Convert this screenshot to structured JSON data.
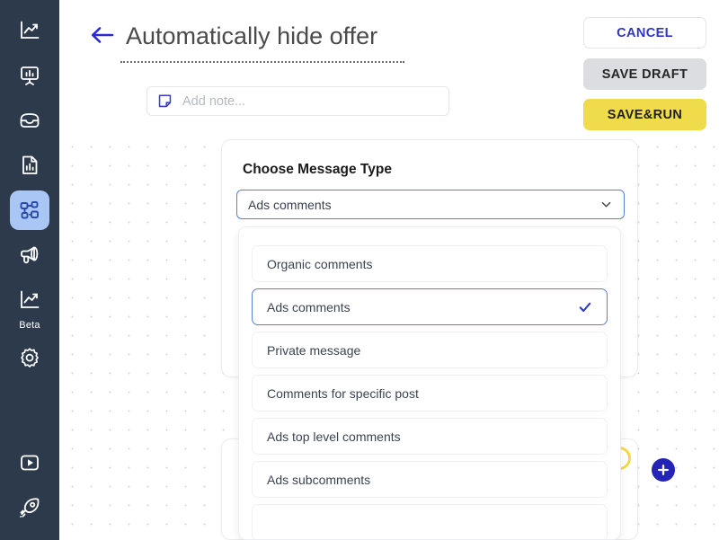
{
  "sidebar": {
    "items": [
      {
        "name": "analytics-chart-icon",
        "icon": "line-chart-axis-icon",
        "label": ""
      },
      {
        "name": "presentation-board-icon",
        "icon": "presentation-chart-icon",
        "label": ""
      },
      {
        "name": "inbox-icon",
        "icon": "inbox-tray-icon",
        "label": ""
      },
      {
        "name": "report-document-icon",
        "icon": "document-bar-chart-icon",
        "label": ""
      },
      {
        "name": "automation-flow-icon",
        "icon": "nodes-flow-icon",
        "label": ""
      },
      {
        "name": "campaign-megaphone-icon",
        "icon": "megaphone-icon",
        "label": ""
      },
      {
        "name": "beta-analytics-icon",
        "icon": "line-chart-axis-icon",
        "label": "Beta"
      },
      {
        "name": "settings-icon",
        "icon": "gear-icon",
        "label": ""
      }
    ],
    "bottom_items": [
      {
        "name": "tutorial-video-icon",
        "icon": "play-square-icon",
        "label": ""
      },
      {
        "name": "whats-new-rocket-icon",
        "icon": "rocket-icon",
        "label": ""
      }
    ],
    "beta_label": "Beta",
    "active_index": 4,
    "background_color": "#2c3a4b",
    "active_color": "#a9c6f5"
  },
  "header": {
    "back_label": "back-arrow",
    "title": "Automatically hide offer",
    "note": {
      "placeholder": "Add note...",
      "value": ""
    },
    "buttons": {
      "cancel": "CANCEL",
      "save_draft": "SAVE DRAFT",
      "save_run": "SAVE&RUN"
    },
    "colors": {
      "cancel_text": "#2f35c7",
      "draft_bg": "#dcdde0",
      "run_bg": "#f0dc4a"
    }
  },
  "node_card": {
    "heading": "Choose Message Type",
    "select": {
      "value": "Ads comments",
      "expanded": true
    }
  },
  "dropdown": {
    "options": [
      {
        "label": "Organic comments",
        "selected": false
      },
      {
        "label": "Ads comments",
        "selected": true
      },
      {
        "label": "Private message",
        "selected": false
      },
      {
        "label": "Comments for specific post",
        "selected": false
      },
      {
        "label": "Ads top level comments",
        "selected": false
      },
      {
        "label": "Ads subcomments",
        "selected": false
      },
      {
        "label": "",
        "selected": false
      }
    ],
    "selected_color": "#2a3cc4"
  },
  "canvas": {
    "add_node_label": "+",
    "accent_blue": "#2323b5",
    "accent_yellow": "#f3d94a",
    "dot_color": "#cfd4da"
  }
}
